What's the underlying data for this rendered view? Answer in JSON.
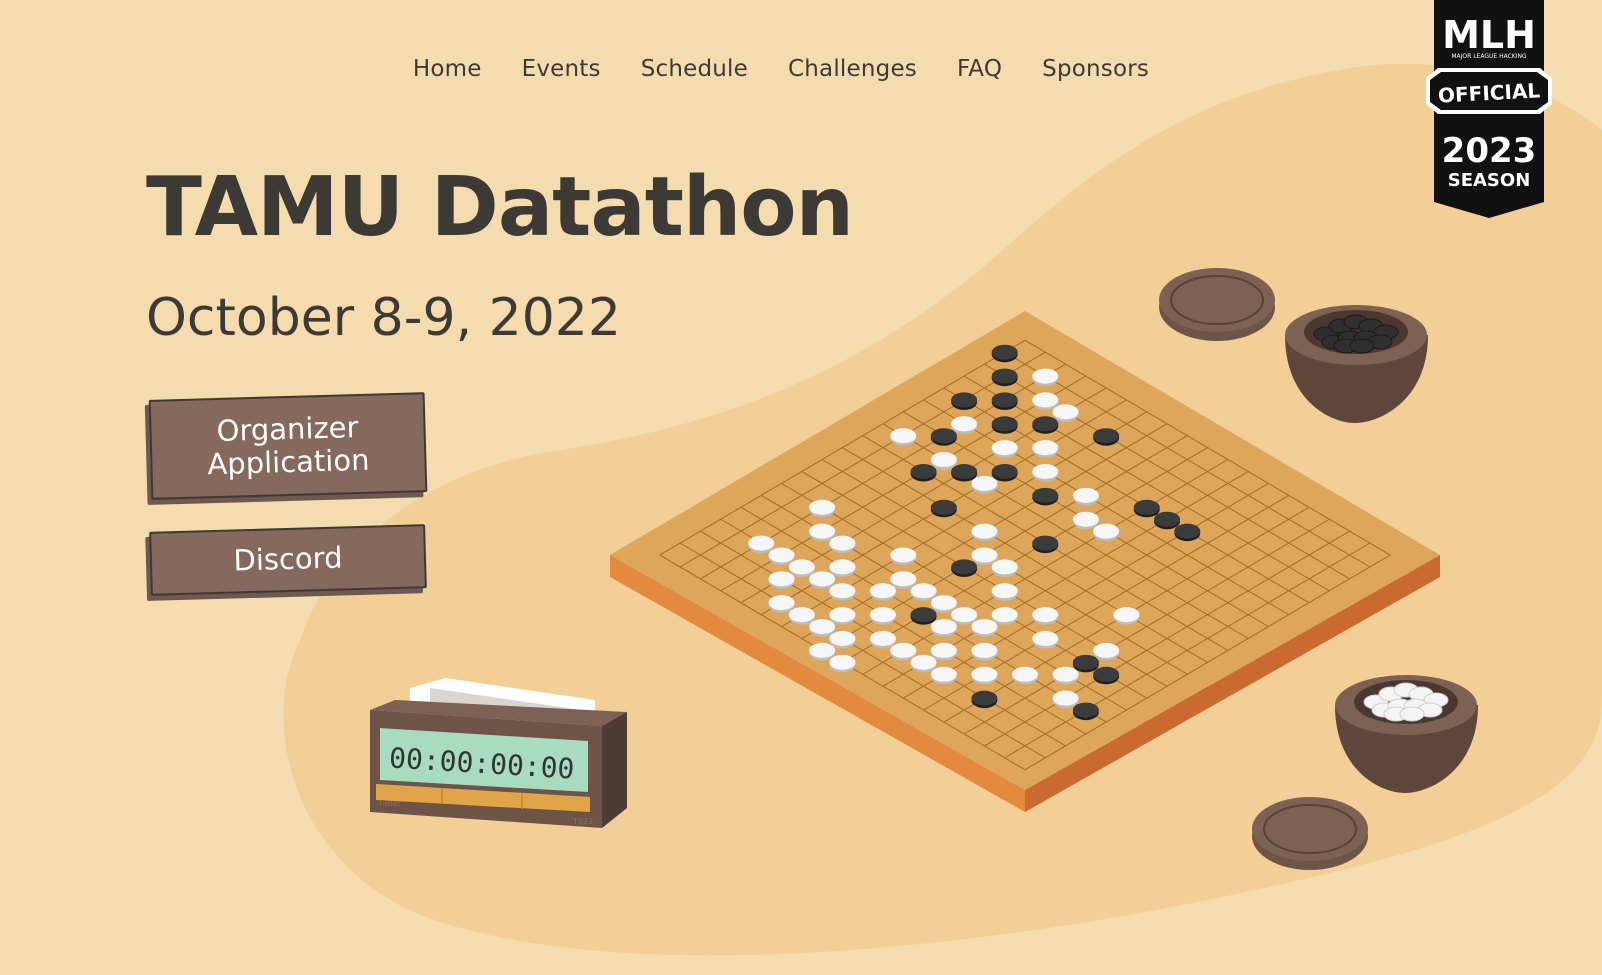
{
  "nav": {
    "items": [
      {
        "label": "Home"
      },
      {
        "label": "Events"
      },
      {
        "label": "Schedule"
      },
      {
        "label": "Challenges"
      },
      {
        "label": "FAQ"
      },
      {
        "label": "Sponsors"
      }
    ]
  },
  "hero": {
    "title": "TAMU Datathon",
    "date": "October 8-9, 2022",
    "buttons": {
      "organizer_line1": "Organizer",
      "organizer_line2": "Application",
      "discord": "Discord"
    }
  },
  "badge": {
    "top": "MLH",
    "small": "MAJOR LEAGUE HACKING",
    "middle": "OFFICIAL",
    "year": "2023",
    "season": "SEASON"
  },
  "clock": {
    "display": "00:00:00:00",
    "brand": "Timer",
    "model": "T022"
  },
  "colors": {
    "background": "#f5dcaf",
    "blob": "#f2cf96",
    "board": "#dda65a",
    "button": "#84695c",
    "text": "#3d3a36"
  },
  "icons": [
    "mlh-badge-icon",
    "go-board-icon",
    "go-stones-bowl-icon",
    "chess-clock-icon"
  ]
}
